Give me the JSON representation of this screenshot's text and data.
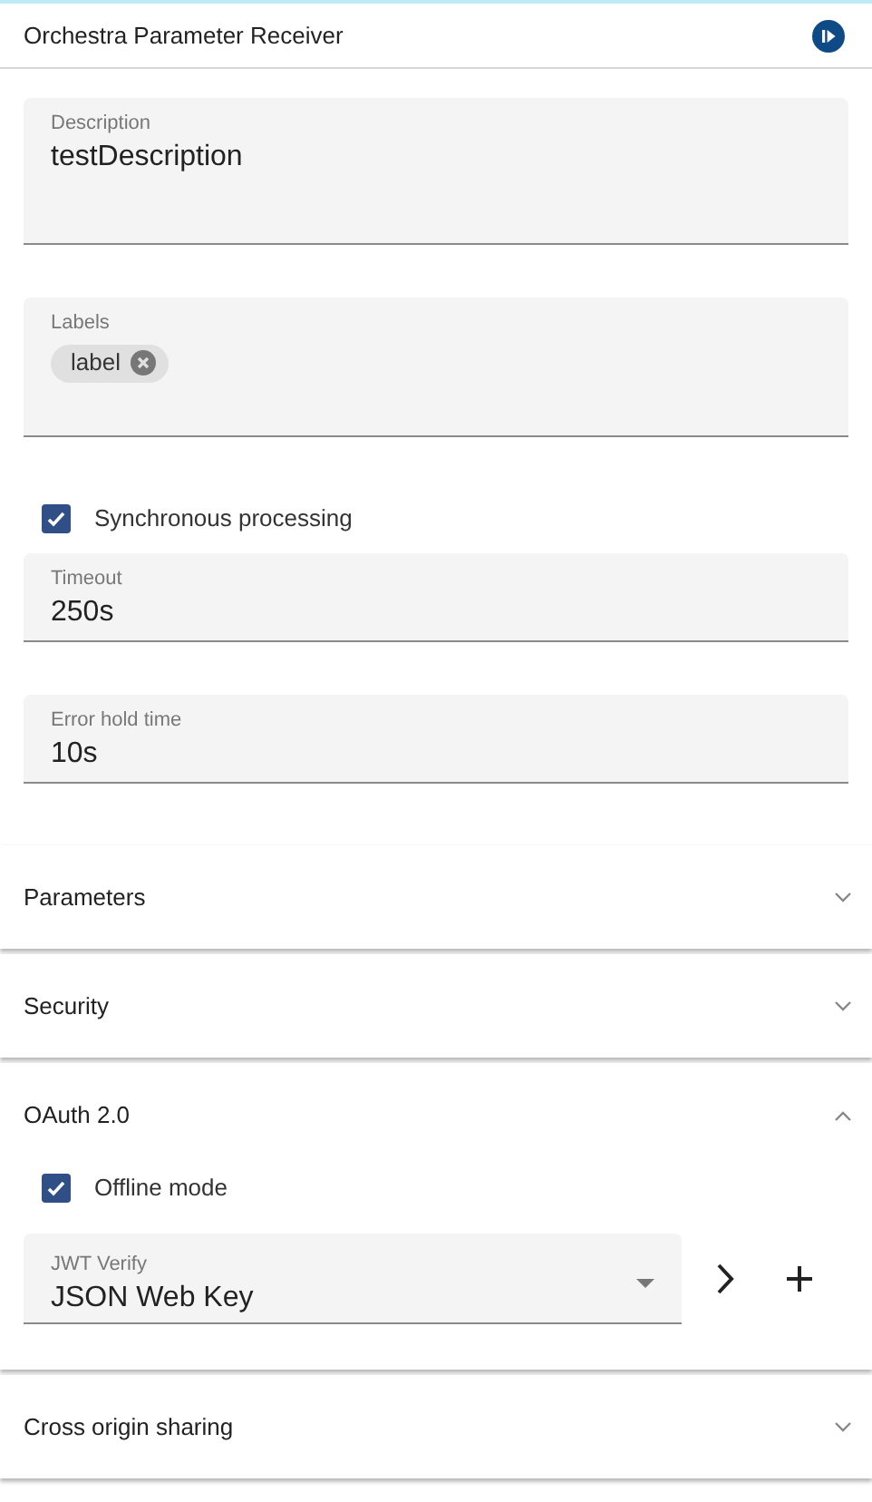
{
  "header": {
    "title": "Orchestra Parameter Receiver"
  },
  "form": [
    {
      "kind": "textarea",
      "label": "Description",
      "value": "testDescription"
    },
    {
      "kind": "chips",
      "label": "Labels",
      "chips": [
        "label"
      ]
    },
    {
      "kind": "checkbox",
      "label": "Synchronous processing",
      "checked": true
    },
    {
      "kind": "text",
      "label": "Timeout",
      "value": "250s"
    },
    {
      "kind": "text",
      "label": "Error hold time",
      "value": "10s"
    }
  ],
  "panels": [
    {
      "title": "Parameters",
      "expanded": false
    },
    {
      "title": "Security",
      "expanded": false
    },
    {
      "title": "OAuth 2.0",
      "expanded": true,
      "offline": {
        "label": "Offline mode",
        "checked": true
      },
      "select": {
        "label": "JWT Verify",
        "value": "JSON Web Key"
      }
    },
    {
      "title": "Cross origin sharing",
      "expanded": false
    }
  ]
}
